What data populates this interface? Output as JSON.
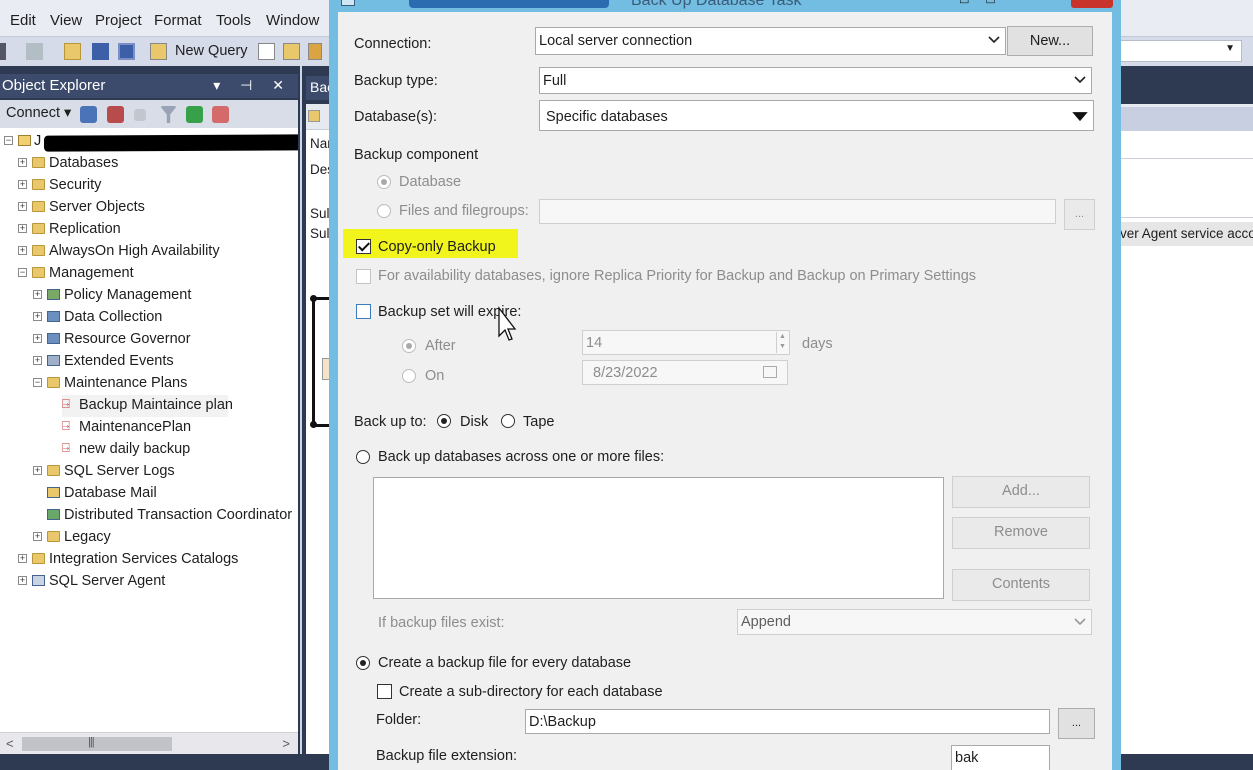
{
  "menu": [
    "Edit",
    "View",
    "Project",
    "Format",
    "Tools",
    "Window"
  ],
  "toolbar": {
    "new_query": "New Query"
  },
  "object_explorer": {
    "title": "Object Explorer",
    "connect_label": "Connect",
    "tree": [
      {
        "label": "Databases"
      },
      {
        "label": "Security"
      },
      {
        "label": "Server Objects"
      },
      {
        "label": "Replication"
      },
      {
        "label": "AlwaysOn High Availability"
      },
      {
        "label": "Management"
      },
      {
        "label": "Policy Management"
      },
      {
        "label": "Data Collection"
      },
      {
        "label": "Resource Governor"
      },
      {
        "label": "Extended Events"
      },
      {
        "label": "Maintenance Plans"
      },
      {
        "label": "Backup Maintaince plan"
      },
      {
        "label": "MaintenancePlan"
      },
      {
        "label": "new daily backup"
      },
      {
        "label": "SQL Server Logs"
      },
      {
        "label": "Database Mail"
      },
      {
        "label": "Distributed Transaction Coordinator"
      },
      {
        "label": "Legacy"
      },
      {
        "label": "Integration Services Catalogs"
      },
      {
        "label": "SQL Server Agent"
      }
    ]
  },
  "doc": {
    "tab": "Bac",
    "row_name": "Nar",
    "row_desc": "Des",
    "row_sub1": "Sul",
    "row_sub2": "Sul",
    "agent_text": "ver Agent service accour"
  },
  "dialog": {
    "title": "Back Up Database Task",
    "connection_label": "Connection:",
    "connection_value": "Local server connection",
    "new_button": "New...",
    "backup_type_label": "Backup type:",
    "backup_type_value": "Full",
    "databases_label": "Database(s):",
    "databases_value": "Specific databases",
    "backup_component_label": "Backup component",
    "component_database": "Database",
    "component_files": "Files and filegroups:",
    "ellipsis": "...",
    "copy_only": "Copy-only Backup",
    "availability_option": "For availability databases, ignore Replica Priority for Backup and Backup on Primary Settings",
    "expire_label": "Backup set will expire:",
    "after_label": "After",
    "after_value": "14",
    "days_label": "days",
    "on_label": "On",
    "on_value": "8/23/2022",
    "backup_to_label": "Back up to:",
    "disk_label": "Disk",
    "tape_label": "Tape",
    "across_files_label": "Back up databases across one or more files:",
    "add_button": "Add...",
    "remove_button": "Remove",
    "contents_button": "Contents",
    "if_exists_label": "If backup files exist:",
    "if_exists_value": "Append",
    "every_db_label": "Create a backup file for every database",
    "subdir_label": "Create a sub-directory for each database",
    "folder_label": "Folder:",
    "folder_value": "D:\\Backup",
    "folder_browse": "...",
    "extension_label": "Backup file extension:",
    "extension_value": "bak"
  },
  "colors": {
    "highlight": "#f2f51c",
    "dialog_frame": "#72bde1",
    "ssms_dark": "#2d3a52"
  }
}
